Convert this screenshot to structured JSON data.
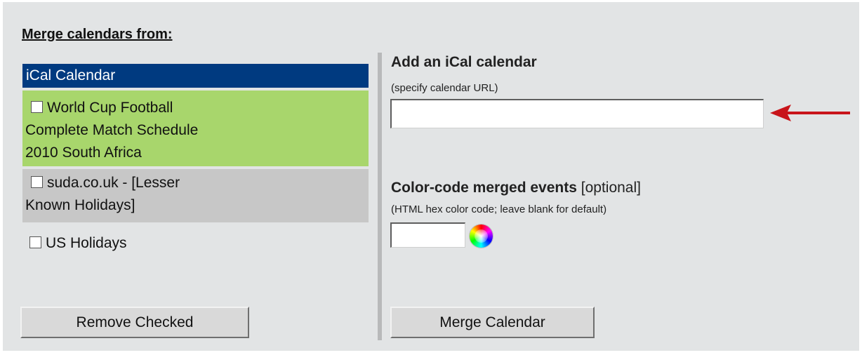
{
  "left": {
    "heading": "Merge calendars from:",
    "list_header": "iCal Calendar",
    "calendars": [
      {
        "line1": "World Cup Football",
        "line2": "Complete Match Schedule",
        "line3": "2010 South Africa",
        "checked": false,
        "color": "#a8d66c"
      },
      {
        "line1": "suda.co.uk - [Lesser",
        "line2": "Known Holidays]",
        "checked": false,
        "color": "#c7c7c7"
      },
      {
        "line1": "US Holidays",
        "checked": false
      }
    ],
    "remove_button": "Remove Checked"
  },
  "right": {
    "ical_heading": "Add an iCal calendar",
    "ical_hint": "(specify calendar URL)",
    "url_value": "",
    "color_heading": "Color-code merged events",
    "color_optional": "[optional]",
    "color_hint": "(HTML hex color code; leave blank for default)",
    "color_value": "",
    "merge_button": "Merge Calendar"
  },
  "colors": {
    "header_blue": "#003a80",
    "arrow_red": "#c8141a",
    "panel_bg": "#e2e4e5"
  },
  "icons": {
    "arrow": "red-arrow-pointing-left-icon",
    "color_picker": "color-wheel-icon"
  }
}
